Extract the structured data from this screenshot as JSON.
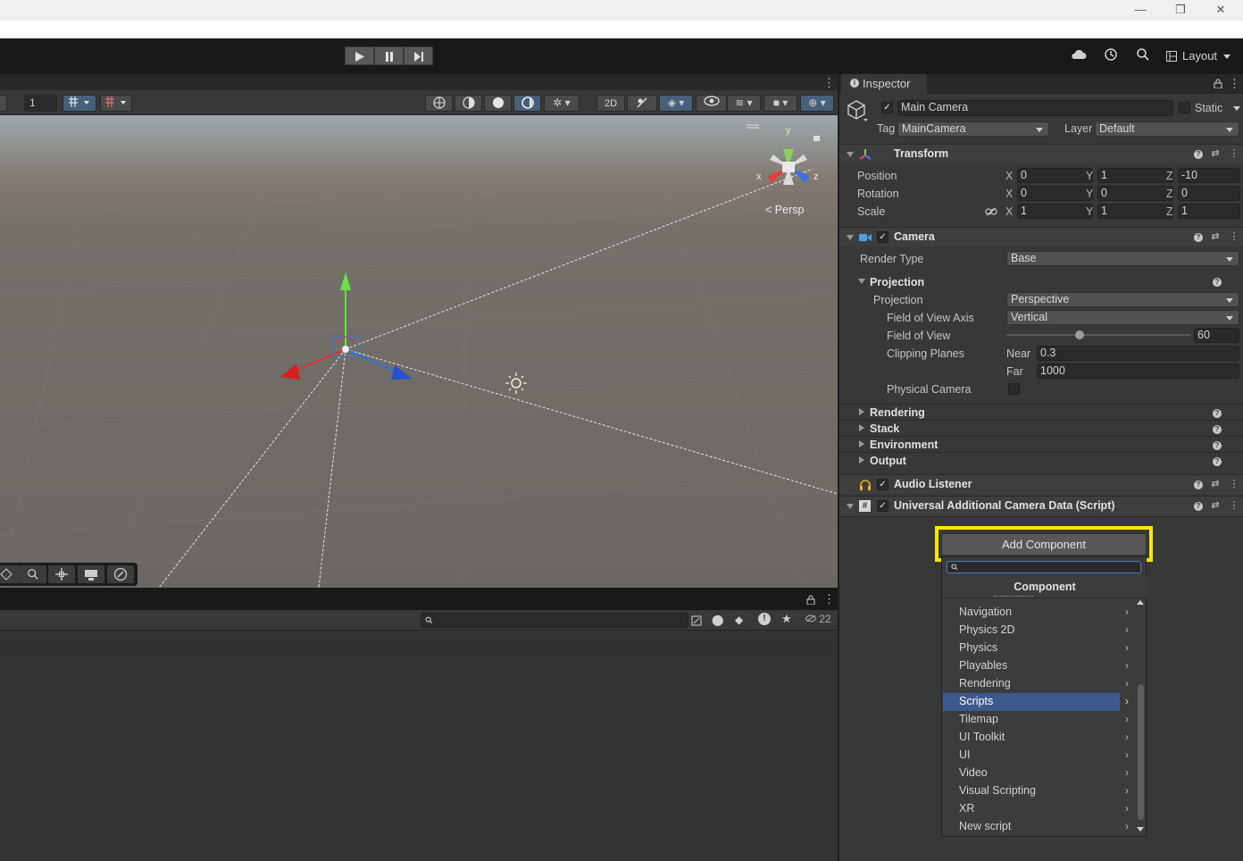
{
  "window": {
    "minimize": "—",
    "restore": "❐",
    "close": "✕"
  },
  "toolbar": {
    "layout_label": "Layout"
  },
  "scene": {
    "page_field": "1",
    "persp_label": "Persp",
    "gizmo_y": "y",
    "gizmo_x": "x",
    "gizmo_z": "z"
  },
  "project": {
    "hidden_count": "22"
  },
  "inspector": {
    "tab_label": "Inspector",
    "object_name": "Main Camera",
    "static_label": "Static",
    "tag_label": "Tag",
    "tag_value": "MainCamera",
    "layer_label": "Layer",
    "layer_value": "Default",
    "transform": {
      "title": "Transform",
      "position_label": "Position",
      "rotation_label": "Rotation",
      "scale_label": "Scale",
      "position": {
        "x": "0",
        "y": "1",
        "z": "-10"
      },
      "rotation": {
        "x": "0",
        "y": "0",
        "z": "0"
      },
      "scale": {
        "x": "1",
        "y": "1",
        "z": "1"
      },
      "x": "X",
      "y": "Y",
      "z": "Z"
    },
    "camera": {
      "title": "Camera",
      "render_type_label": "Render Type",
      "render_type_value": "Base",
      "projection_section": "Projection",
      "projection_label": "Projection",
      "projection_value": "Perspective",
      "fov_axis_label": "Field of View Axis",
      "fov_axis_value": "Vertical",
      "fov_label": "Field of View",
      "fov_value": "60",
      "fov_fraction": 0.4,
      "clipping_label": "Clipping Planes",
      "near_label": "Near",
      "near_value": "0.3",
      "far_label": "Far",
      "far_value": "1000",
      "physical_label": "Physical Camera",
      "sections": [
        "Rendering",
        "Stack",
        "Environment",
        "Output"
      ]
    },
    "audio_listener": {
      "title": "Audio Listener"
    },
    "uacd": {
      "title": "Universal Additional Camera Data (Script)"
    },
    "add_component": {
      "button_label": "Add Component",
      "popup_title": "Component",
      "items": [
        "Navigation",
        "Physics 2D",
        "Physics",
        "Playables",
        "Rendering",
        "Scripts",
        "Tilemap",
        "UI Toolkit",
        "UI",
        "Video",
        "Visual Scripting",
        "XR",
        "New script"
      ],
      "selected": "Scripts"
    }
  },
  "colors": {
    "highlight": "#ffe600",
    "selection": "#3d5a8e",
    "accent_blue": "#46607c"
  }
}
